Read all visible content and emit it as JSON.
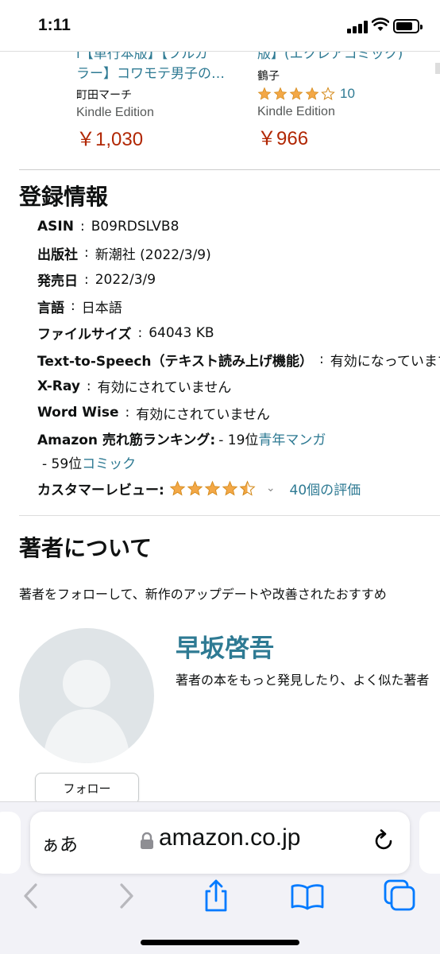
{
  "status_bar": {
    "time": "1:11"
  },
  "carousel": {
    "items": [
      {
        "title_line1": "l【単行本版】【フルカ",
        "title_line2": "ラー】コワモテ男子の…",
        "author": "町田マーチ",
        "edition": "Kindle Edition",
        "price": "￥1,030"
      },
      {
        "title_line1": "版】(エクレアコミック)",
        "author": "鶴子",
        "rating": 4,
        "rating_count": "10",
        "edition": "Kindle Edition",
        "price": "￥966"
      }
    ]
  },
  "details": {
    "heading": "登録情報",
    "rows": [
      {
        "key": "ASIN",
        "value": "B09RDSLVB8"
      },
      {
        "key": "出版社",
        "value": "新潮社 (2022/3/9)"
      },
      {
        "key": "発売日",
        "value": "2022/3/9"
      },
      {
        "key": "言語",
        "value": "日本語"
      },
      {
        "key": "ファイルサイズ",
        "value": "64043 KB"
      },
      {
        "key": "Text-to-Speech（テキスト読み上げ機能）",
        "value": "有効になっています"
      },
      {
        "key": "X-Ray",
        "value": "有効にされていません"
      },
      {
        "key": "Word Wise",
        "value": "有効にされていません"
      }
    ],
    "ranking": {
      "key": "Amazon 売れ筋ランキング:",
      "rank1": "- 19位",
      "cat1": "青年マンガ",
      "rank2": "- 59位",
      "cat2": "コミック"
    },
    "reviews": {
      "key": "カスタマーレビュー:",
      "rating": 4.5,
      "link": "40個の評価"
    }
  },
  "about_author": {
    "heading": "著者について",
    "follow_desc": "著者をフォローして、新作のアップデートや改善されたおすすめ",
    "name": "早坂啓吾",
    "desc": "著者の本をもっと発見したり、よく似た著者",
    "follow_button": "フォロー"
  },
  "safari": {
    "aa_label": "ぁあ",
    "url": "amazon.co.jp"
  },
  "colors": {
    "link": "#2e7a93",
    "price": "#b12704",
    "star": "#f3a847",
    "ios_blue": "#007aff"
  }
}
